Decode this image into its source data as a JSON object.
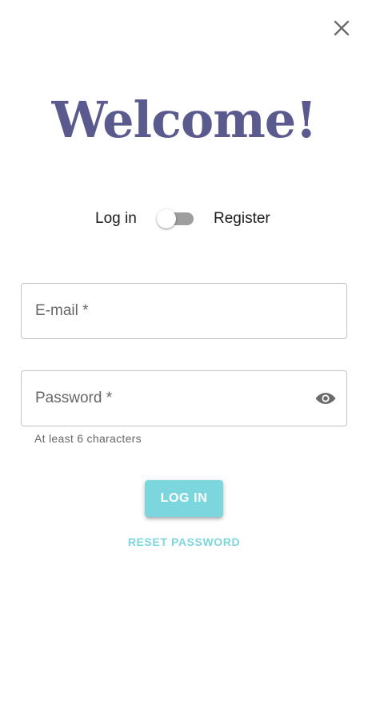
{
  "dialog": {
    "close_icon": "close-icon",
    "title": "Welcome!"
  },
  "mode_switch": {
    "left_label": "Log in",
    "right_label": "Register",
    "checked": false
  },
  "form": {
    "email": {
      "label": "E-mail *",
      "value": ""
    },
    "password": {
      "label": "Password *",
      "value": "",
      "visibility_icon": "eye-icon",
      "helper_text": "At least 6 characters"
    }
  },
  "actions": {
    "login_label": "LOG IN",
    "reset_label": "RESET PASSWORD"
  },
  "colors": {
    "title": "#5b5a8e",
    "accent": "#7cd6de",
    "switch_track": "#9e9e9e"
  }
}
